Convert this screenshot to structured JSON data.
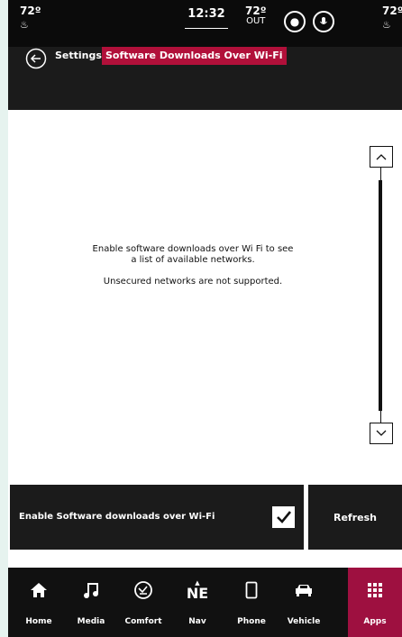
{
  "status": {
    "left_temp": "72º",
    "clock": "12:32",
    "out_temp": "72º",
    "out_label": "OUT",
    "right_temp": "72º"
  },
  "header": {
    "breadcrumb": "Settings",
    "title": "Software Downloads Over Wi-Fi"
  },
  "content": {
    "message_line1": "Enable software downloads over Wi Fi to see",
    "message_line2": "a list of available networks.",
    "message_line3": "Unsecured networks are not supported."
  },
  "controls": {
    "enable_label": "Enable Software downloads over Wi-Fi",
    "enable_checked": true,
    "refresh_label": "Refresh"
  },
  "nav": {
    "heading": "NE",
    "items": [
      {
        "label": "Home",
        "icon": "home-icon"
      },
      {
        "label": "Media",
        "icon": "music-note-icon"
      },
      {
        "label": "Comfort",
        "icon": "comfort-icon"
      },
      {
        "label": "Nav",
        "icon": "compass-icon"
      },
      {
        "label": "Phone",
        "icon": "phone-icon"
      },
      {
        "label": "Vehicle",
        "icon": "vehicle-icon"
      },
      {
        "label": "Apps",
        "icon": "apps-grid-icon"
      }
    ],
    "active": "Apps"
  },
  "colors": {
    "accent": "#b1103a",
    "background": "#1b1b1b"
  }
}
